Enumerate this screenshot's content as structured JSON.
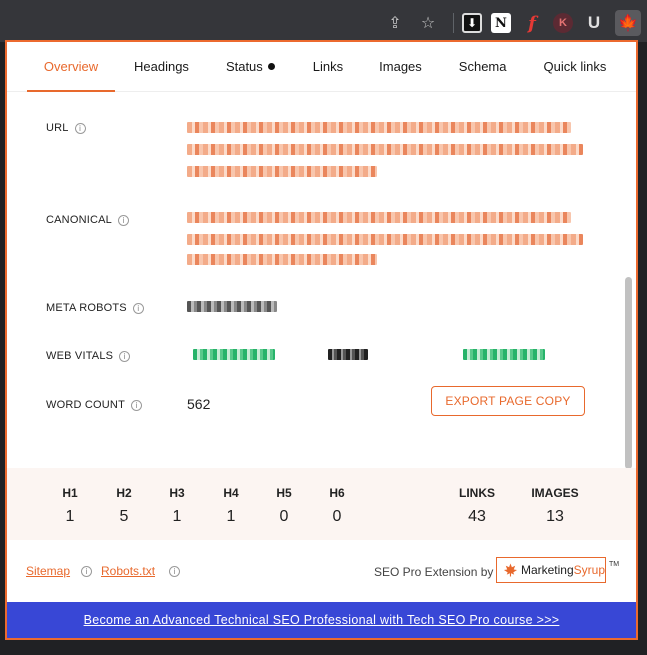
{
  "browser": {
    "share_glyph": "⇪",
    "star_glyph": "☆",
    "extensions": [
      {
        "name": "download-ext",
        "glyph": "⬇"
      },
      {
        "name": "notion-ext",
        "glyph": "N"
      },
      {
        "name": "flash-ext",
        "glyph": "f"
      },
      {
        "name": "k-ext",
        "glyph": "K"
      },
      {
        "name": "u-ext",
        "glyph": "U"
      },
      {
        "name": "seo-pro-ext",
        "glyph": "🍁"
      }
    ]
  },
  "tabs": {
    "overview": "Overview",
    "headings": "Headings",
    "status": "Status",
    "links": "Links",
    "images": "Images",
    "schema": "Schema",
    "quick_links": "Quick links"
  },
  "fields": {
    "url_label": "URL",
    "canonical_label": "CANONICAL",
    "meta_robots_label": "META ROBOTS",
    "web_vitals_label": "WEB VITALS",
    "word_count_label": "WORD COUNT",
    "word_count_value": "562",
    "info_glyph": "i"
  },
  "export_button": "EXPORT PAGE COPY",
  "counts": [
    {
      "label": "H1",
      "value": "1"
    },
    {
      "label": "H2",
      "value": "5"
    },
    {
      "label": "H3",
      "value": "1"
    },
    {
      "label": "H4",
      "value": "1"
    },
    {
      "label": "H5",
      "value": "0"
    },
    {
      "label": "H6",
      "value": "0"
    },
    {
      "label": "LINKS",
      "value": "43"
    },
    {
      "label": "IMAGES",
      "value": "13"
    }
  ],
  "footer": {
    "sitemap": "Sitemap",
    "robots": "Robots.txt",
    "powered_by": "SEO Pro Extension by",
    "brand_a": "Marketing",
    "brand_b": "Syrup",
    "tm": "TM"
  },
  "banner": "Become an Advanced Technical SEO Professional with Tech SEO Pro course >>>",
  "colors": {
    "accent": "#e8692d",
    "banner": "#3847d6"
  }
}
